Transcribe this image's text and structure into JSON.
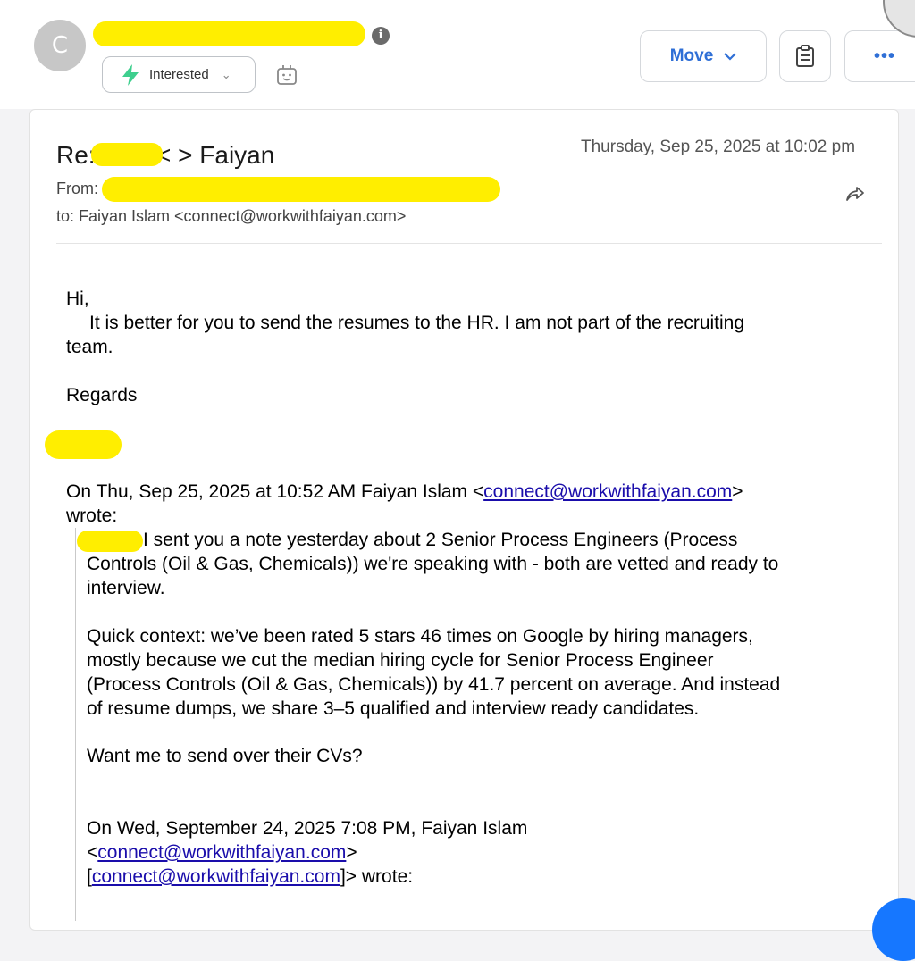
{
  "header": {
    "avatar_letter": "C",
    "tag_label": "Interested",
    "move_label": "Move",
    "more_label": "•••"
  },
  "email": {
    "subject_prefix": "Re:",
    "subject_suffix": "< > Faiyan",
    "date": "Thursday, Sep 25, 2025 at 10:02 pm",
    "from_label": "From:",
    "to_text": "to: Faiyan Islam <connect@workwithfaiyan.com>"
  },
  "body": {
    "greeting": "Hi,",
    "line1": "It is better for you to send the resumes to the HR. I am not part of the recruiting",
    "line2": "team.",
    "signoff": "Regards"
  },
  "quote": {
    "attribution_pre": "On Thu, Sep 25, 2025 at 10:52 AM Faiyan Islam <",
    "attribution_link": "connect@workwithfaiyan.com",
    "attribution_post": ">",
    "attribution_wrote": "wrote:",
    "p1_line1": "I sent you a note yesterday about 2 Senior Process Engineers  (Process",
    "p1_line2": "Controls (Oil & Gas, Chemicals)) we're speaking with - both are vetted and ready to",
    "p1_line3": "interview.",
    "p2_line1": "Quick context: we’ve been rated 5 stars 46 times on Google by hiring managers,",
    "p2_line2": "mostly because we cut the median hiring cycle for Senior Process Engineer",
    "p2_line3": "(Process Controls (Oil & Gas, Chemicals)) by 41.7 percent on average. And instead",
    "p2_line4": "of resume dumps, we share 3–5 qualified and interview ready candidates.",
    "p3": "Want me to send over their CVs?",
    "nested_line1": "On Wed, September 24, 2025 7:08 PM, Faiyan Islam",
    "nested_open": "<",
    "nested_link1": "connect@workwithfaiyan.com",
    "nested_close": ">",
    "nested_bracket_open": "[",
    "nested_link2": "connect@workwithfaiyan.com",
    "nested_bracket_close": "]",
    "nested_wrote": "> wrote:"
  },
  "colors": {
    "accent": "#2f6fd6",
    "redaction": "#ffee00",
    "link": "#1a0dab",
    "bolt": "#3ecf8e"
  }
}
